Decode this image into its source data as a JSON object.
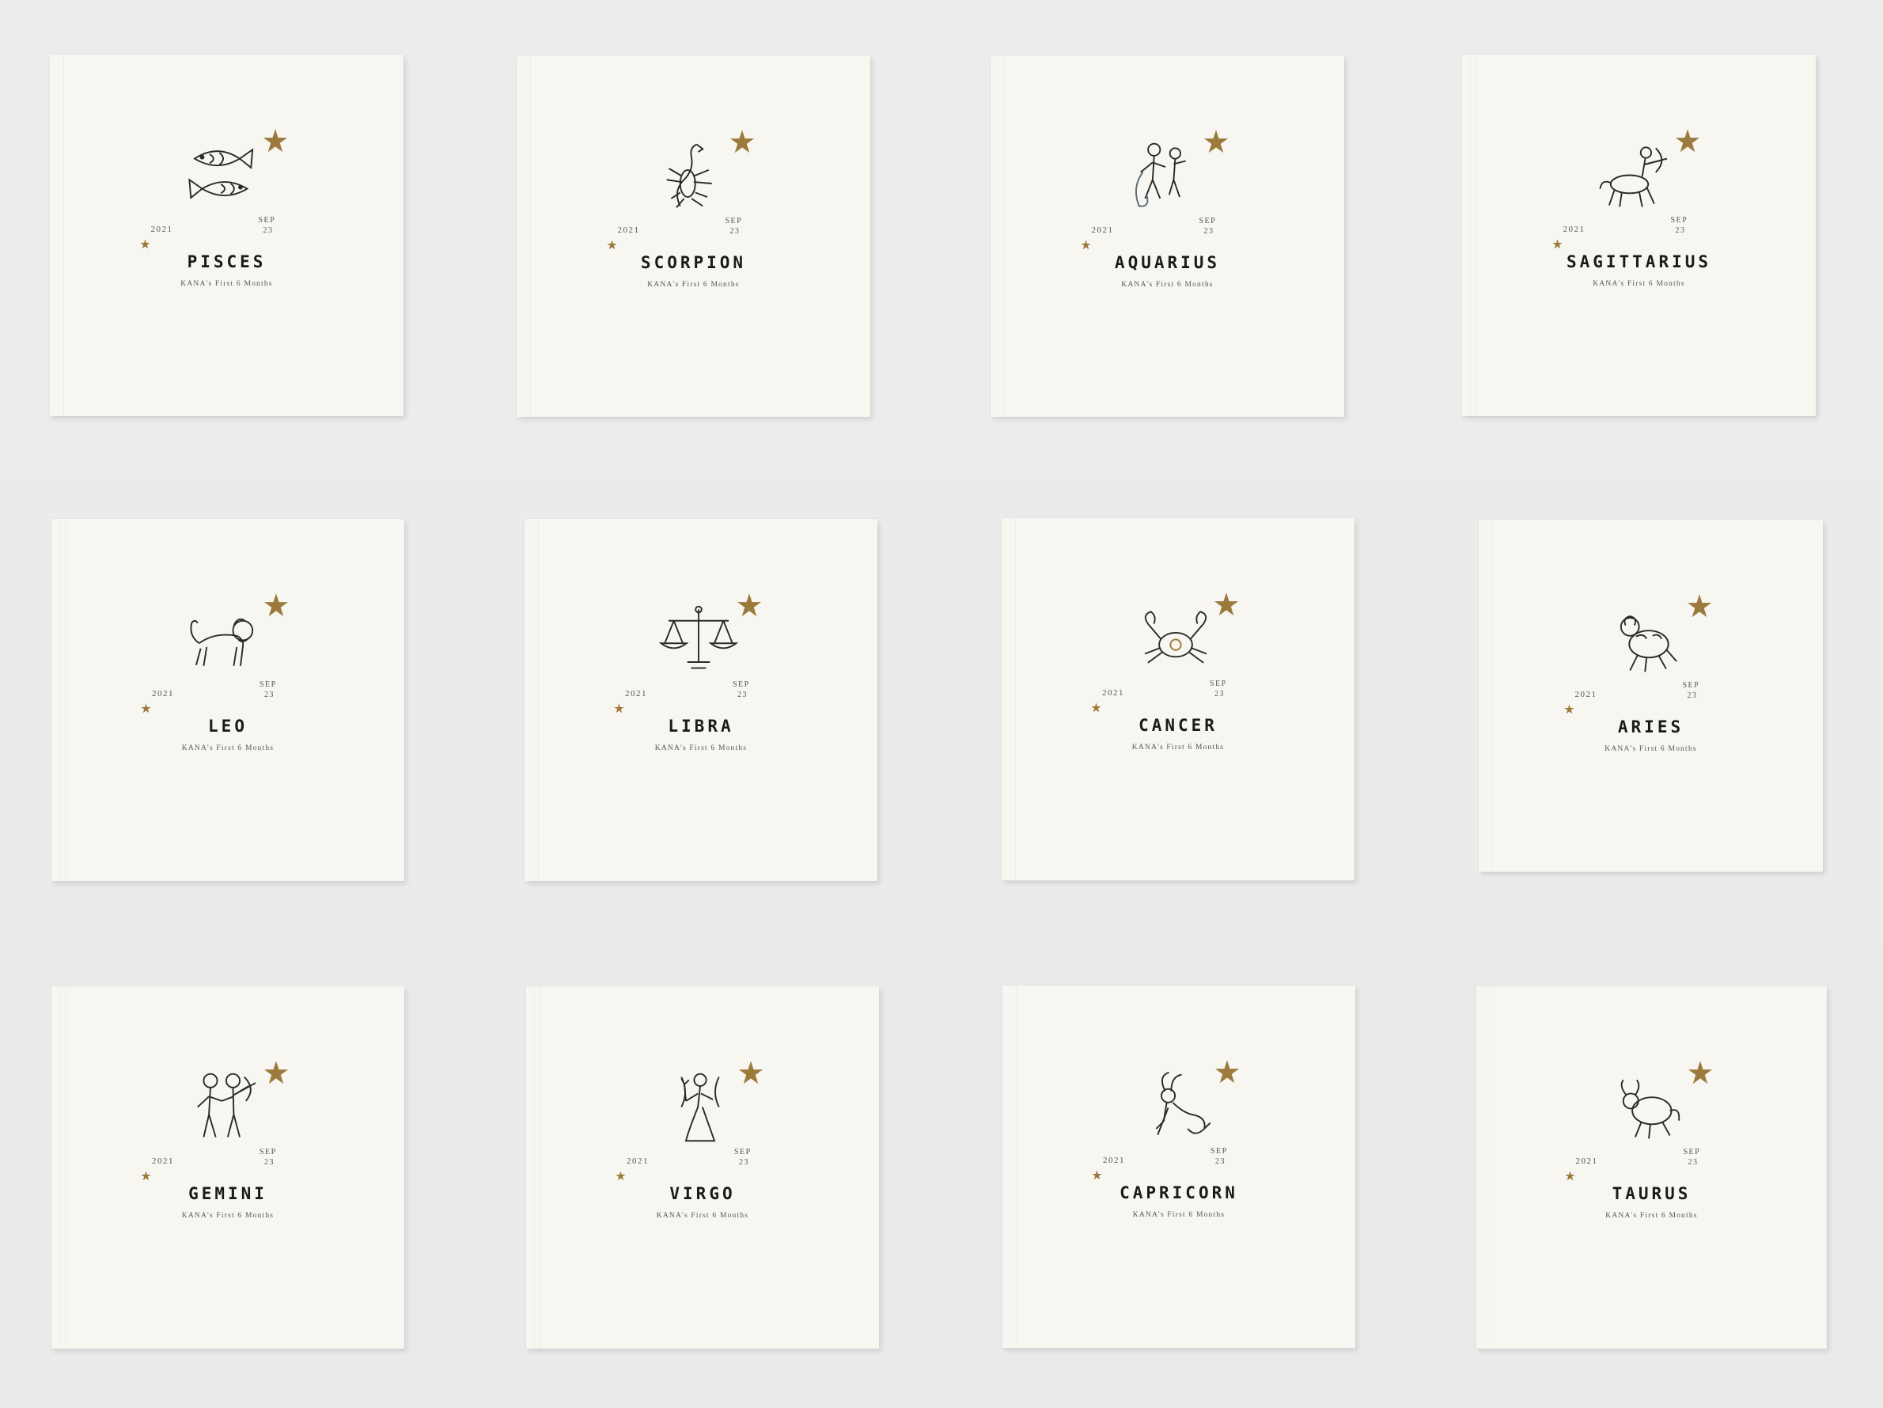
{
  "colors": {
    "background": "#ececec",
    "cover": "#f7f6f1",
    "star": "#9c7a3c",
    "title": "#1a1a1a",
    "ink": "#2a2a2a"
  },
  "books": [
    {
      "sign": "PISCES",
      "icon": "fish-pair-icon",
      "year": "2021",
      "month": "SEP",
      "day": "23",
      "subtitle": "KANA's First 6 Months"
    },
    {
      "sign": "SCORPION",
      "icon": "scorpion-icon",
      "year": "2021",
      "month": "SEP",
      "day": "23",
      "subtitle": "KANA's First 6 Months"
    },
    {
      "sign": "AQUARIUS",
      "icon": "water-bearer-icon",
      "year": "2021",
      "month": "SEP",
      "day": "23",
      "subtitle": "KANA's First 6 Months"
    },
    {
      "sign": "SAGITTARIUS",
      "icon": "archer-centaur-icon",
      "year": "2021",
      "month": "SEP",
      "day": "23",
      "subtitle": "KANA's First 6 Months"
    },
    {
      "sign": "LEO",
      "icon": "lion-icon",
      "year": "2021",
      "month": "SEP",
      "day": "23",
      "subtitle": "KANA's First 6 Months"
    },
    {
      "sign": "LIBRA",
      "icon": "scales-icon",
      "year": "2021",
      "month": "SEP",
      "day": "23",
      "subtitle": "KANA's First 6 Months"
    },
    {
      "sign": "CANCER",
      "icon": "crab-icon",
      "year": "2021",
      "month": "SEP",
      "day": "23",
      "subtitle": "KANA's First 6 Months"
    },
    {
      "sign": "ARIES",
      "icon": "ram-icon",
      "year": "2021",
      "month": "SEP",
      "day": "23",
      "subtitle": "KANA's First 6 Months"
    },
    {
      "sign": "GEMINI",
      "icon": "twins-icon",
      "year": "2021",
      "month": "SEP",
      "day": "23",
      "subtitle": "KANA's First 6 Months"
    },
    {
      "sign": "VIRGO",
      "icon": "maiden-icon",
      "year": "2021",
      "month": "SEP",
      "day": "23",
      "subtitle": "KANA's First 6 Months"
    },
    {
      "sign": "CAPRICORN",
      "icon": "sea-goat-icon",
      "year": "2021",
      "month": "SEP",
      "day": "23",
      "subtitle": "KANA's First 6 Months"
    },
    {
      "sign": "TAURUS",
      "icon": "bull-icon",
      "year": "2021",
      "month": "SEP",
      "day": "23",
      "subtitle": "KANA's First 6 Months"
    }
  ]
}
